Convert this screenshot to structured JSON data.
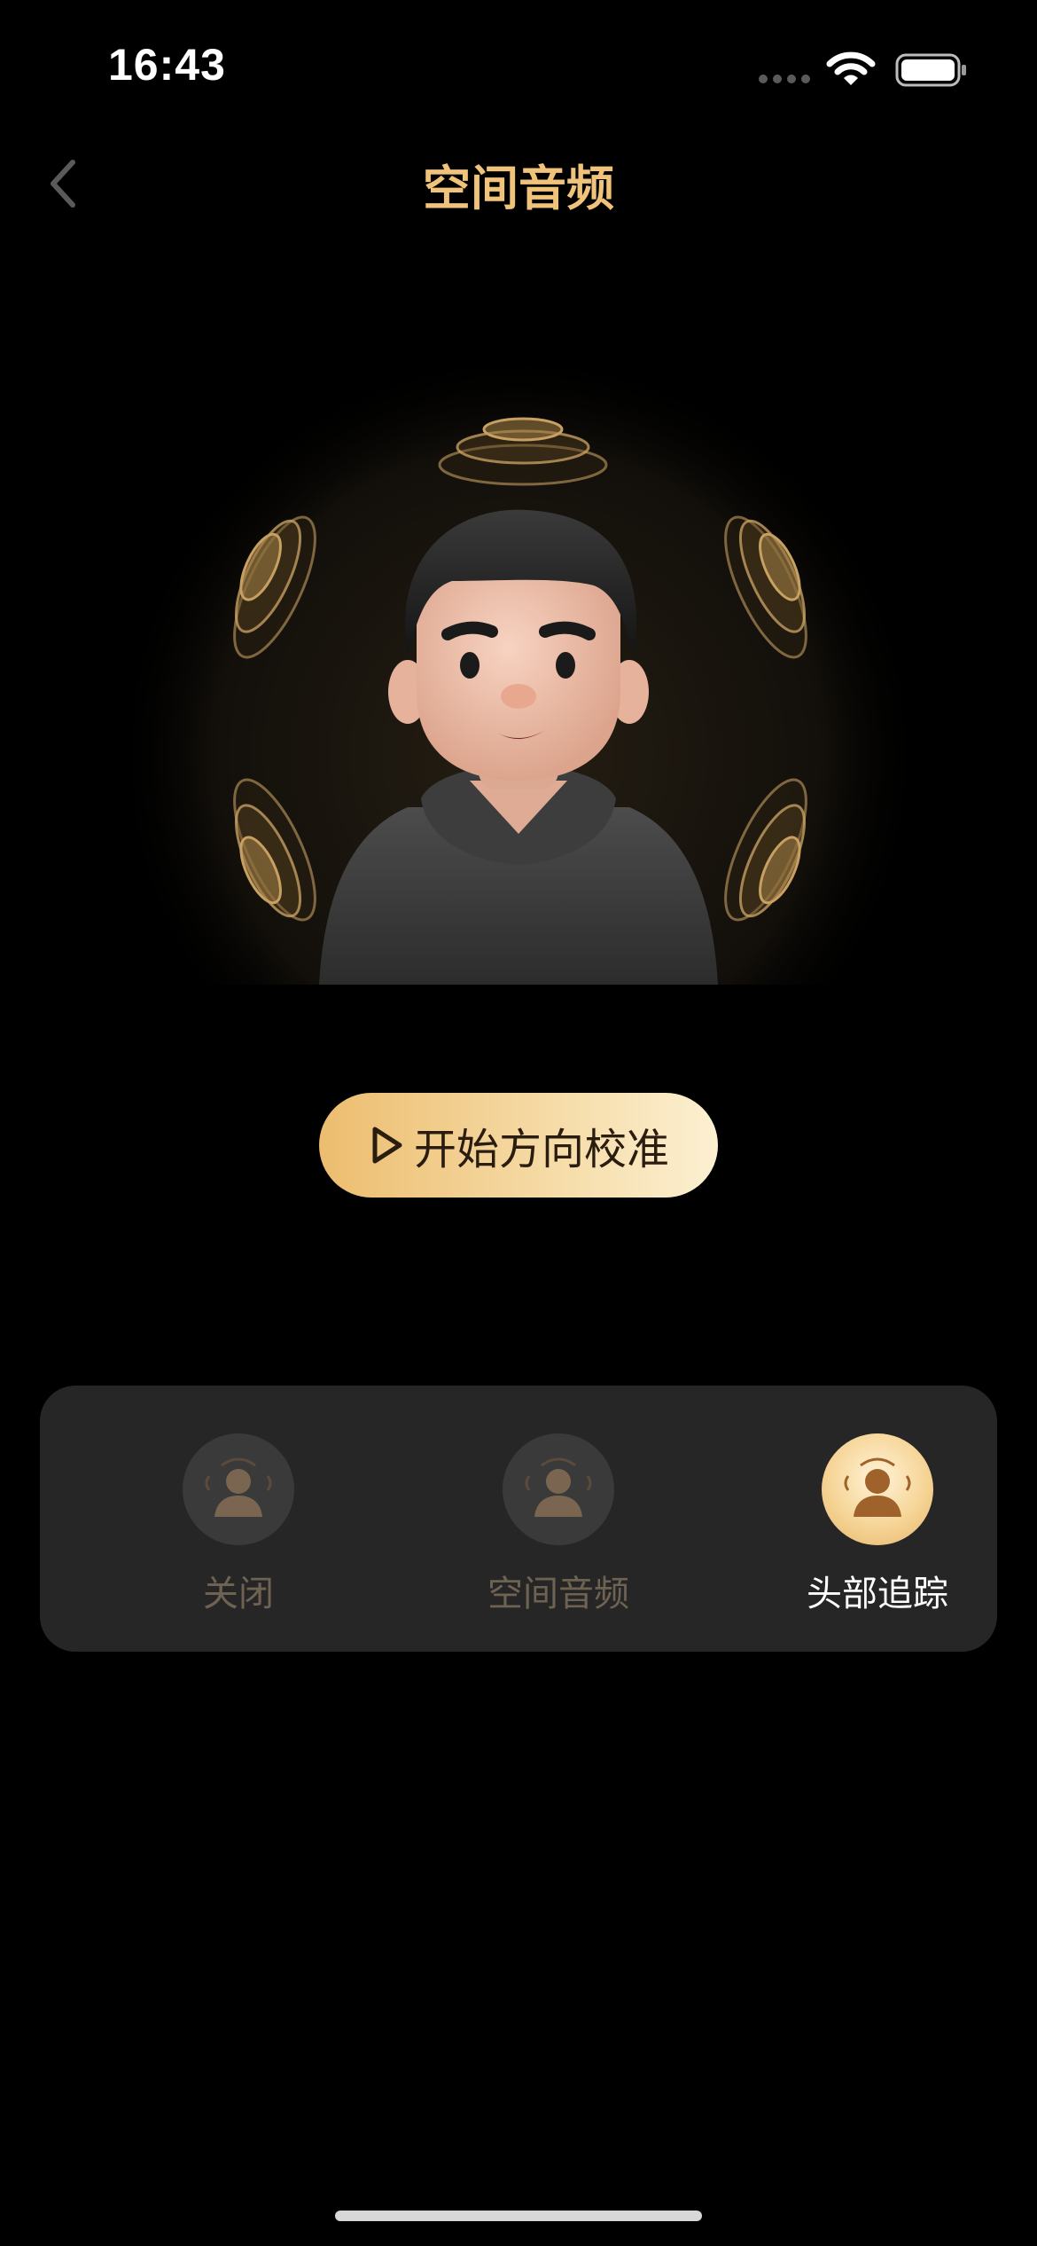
{
  "status": {
    "time": "16:43"
  },
  "nav": {
    "title": "空间音频"
  },
  "calibrate": {
    "label": "开始方向校准"
  },
  "modes": [
    {
      "label": "关闭",
      "active": false
    },
    {
      "label": "空间音频",
      "active": false
    },
    {
      "label": "头部追踪",
      "active": true
    }
  ],
  "colors": {
    "accent": "#f1c27a",
    "panel": "#262626",
    "inactive_label": "#6e6253"
  }
}
